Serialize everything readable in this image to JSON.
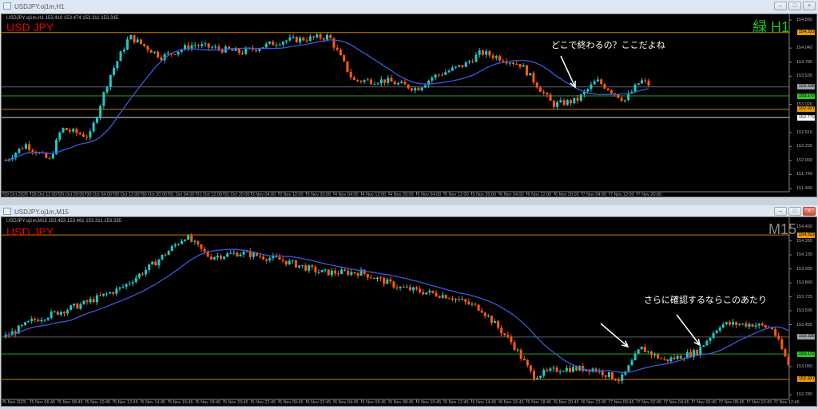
{
  "windows": [
    {
      "title": "USDJPY.oj1m,H1",
      "header": "USDJPY.oj1m,H1  153.419 153.474 153.311 153.335",
      "symbol": "USD JPY",
      "timeframe_label": "緑 H1",
      "timeframe_color": "#22c022",
      "annotation": "どこで終わるの？ここだよね",
      "price_labels": [
        "154.550",
        "154.040",
        "153.785",
        "153.530",
        "153.020",
        "152.510",
        "152.255",
        "152.000",
        "151.745",
        "151.490"
      ],
      "price_range": [
        151.49,
        154.55
      ],
      "level_tags": [
        {
          "price": "154.322",
          "color": "#e89a00"
        },
        {
          "price": "153.336",
          "color": "#9aa0a8"
        },
        {
          "price": "153.172",
          "color": "#2cc22c"
        },
        {
          "price": "152.927",
          "color": "#e89a00"
        },
        {
          "price": "152.779",
          "color": "#ffffff"
        }
      ],
      "time_labels": [
        "29 Oct 2025",
        "29 Oct 12:00",
        "29 Oct 20:00",
        "30 Oct 04:00",
        "30 Oct 12:00",
        "30 Oct 20:00",
        "31 Oct 04:00",
        "31 Oct 12:00",
        "31 Oct 20:00",
        "3 Nov 04:00",
        "3 Nov 12:00",
        "3 Nov 20:00",
        "4 Nov 04:00",
        "4 Nov 12:00",
        "4 Nov 20:00",
        "5 Nov 04:00",
        "5 Nov 12:00",
        "5 Nov 20:00",
        "6 Nov 04:00",
        "6 Nov 12:00",
        "6 Nov 20:00",
        "7 Nov 04:00",
        "7 Nov 12:00",
        "7 Nov 20:00"
      ],
      "price_path": [
        [
          5,
          152.0
        ],
        [
          30,
          152.29
        ],
        [
          60,
          152.0
        ],
        [
          75,
          152.58
        ],
        [
          110,
          152.43
        ],
        [
          135,
          153.52
        ],
        [
          160,
          154.25
        ],
        [
          200,
          153.88
        ],
        [
          240,
          154.1
        ],
        [
          300,
          153.96
        ],
        [
          350,
          154.17
        ],
        [
          410,
          154.25
        ],
        [
          440,
          153.45
        ],
        [
          480,
          153.45
        ],
        [
          520,
          153.3
        ],
        [
          540,
          153.52
        ],
        [
          580,
          153.74
        ],
        [
          600,
          153.96
        ],
        [
          620,
          153.88
        ],
        [
          650,
          153.74
        ],
        [
          690,
          153.01
        ],
        [
          720,
          153.09
        ],
        [
          745,
          153.45
        ],
        [
          780,
          153.09
        ],
        [
          800,
          153.45
        ],
        [
          810,
          153.38
        ]
      ]
    },
    {
      "title": "USDJPY.oj1m,M15",
      "header": "USDJPY.oj1m,M15  153.453 153.461 153.311 153.335",
      "symbol": "USD JPY",
      "timeframe_label": "M15",
      "timeframe_color": "#8a8a8a",
      "annotation": "さらに確認するならこのあたり",
      "price_labels": [
        "154.400",
        "154.265",
        "154.130",
        "153.995",
        "153.860",
        "153.725",
        "153.590",
        "153.455",
        "153.050",
        "152.780"
      ],
      "price_range": [
        152.78,
        154.4
      ],
      "level_tags": [
        {
          "price": "154.322",
          "color": "#e89a00"
        },
        {
          "price": "153.336",
          "color": "#9aa0a8"
        },
        {
          "price": "153.172",
          "color": "#2cc22c"
        },
        {
          "price": "152.927",
          "color": "#e89a00"
        }
      ],
      "time_labels": [
        "5 Nov 2025",
        "5 Nov 06:45",
        "5 Nov 08:45",
        "5 Nov 10:45",
        "5 Nov 12:45",
        "5 Nov 14:45",
        "5 Nov 16:45",
        "5 Nov 18:45",
        "5 Nov 20:45",
        "5 Nov 22:45",
        "6 Nov 00:45",
        "6 Nov 02:45",
        "6 Nov 04:45",
        "6 Nov 06:45",
        "6 Nov 08:45",
        "6 Nov 10:45",
        "6 Nov 12:45",
        "6 Nov 14:45",
        "6 Nov 16:45",
        "6 Nov 18:45",
        "6 Nov 20:45",
        "6 Nov 22:45",
        "7 Nov 00:45",
        "7 Nov 02:45",
        "7 Nov 04:45",
        "7 Nov 06:45",
        "7 Nov 08:45",
        "7 Nov 10:45",
        "7 Nov 12:45"
      ],
      "price_path": [
        [
          5,
          153.34
        ],
        [
          40,
          153.5
        ],
        [
          100,
          153.65
        ],
        [
          150,
          153.81
        ],
        [
          190,
          154.04
        ],
        [
          230,
          154.31
        ],
        [
          260,
          154.11
        ],
        [
          300,
          154.15
        ],
        [
          350,
          154.08
        ],
        [
          400,
          153.96
        ],
        [
          450,
          153.96
        ],
        [
          500,
          153.81
        ],
        [
          560,
          153.73
        ],
        [
          600,
          153.61
        ],
        [
          640,
          153.27
        ],
        [
          665,
          152.96
        ],
        [
          700,
          153.03
        ],
        [
          740,
          153.03
        ],
        [
          775,
          152.92
        ],
        [
          800,
          153.23
        ],
        [
          830,
          153.11
        ],
        [
          870,
          153.19
        ],
        [
          900,
          153.46
        ],
        [
          940,
          153.46
        ],
        [
          965,
          153.42
        ],
        [
          985,
          153.07
        ]
      ]
    }
  ],
  "colors": {
    "bull": "#20c8c8",
    "bear": "#ff5a10",
    "ma": "#3a5adc",
    "background": "#000000"
  }
}
